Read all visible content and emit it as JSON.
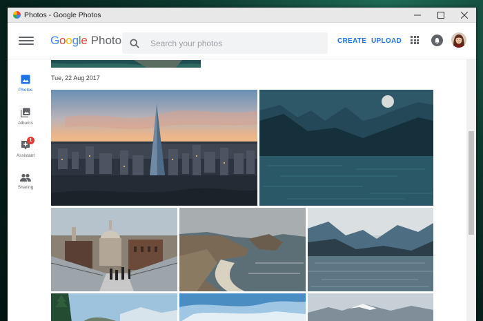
{
  "window": {
    "title": "Photos - Google Photos",
    "controls": [
      "minimize",
      "maximize",
      "close"
    ]
  },
  "header": {
    "logo_google": "Google",
    "logo_photos": "Photos",
    "search_placeholder": "Search your photos",
    "create_label": "CREATE",
    "upload_label": "UPLOAD",
    "icons": [
      "hamburger-menu-icon",
      "search-icon",
      "apps-grid-icon",
      "notifications-icon",
      "avatar"
    ]
  },
  "sidebar": {
    "items": [
      {
        "label": "Photos",
        "icon": "photos-icon",
        "active": true
      },
      {
        "label": "Albums",
        "icon": "albums-icon",
        "active": false
      },
      {
        "label": "Assistant",
        "icon": "assistant-icon",
        "active": false,
        "badge": "1"
      },
      {
        "label": "Sharing",
        "icon": "sharing-icon",
        "active": false
      }
    ]
  },
  "main": {
    "date_heading": "Tue, 22 Aug 2017",
    "photos": [
      "city-sunset-skyscraper",
      "lake-mountains-moon",
      "st-pauls-cathedral-bridge",
      "coastal-cliff-arch",
      "mountain-lake-reflection",
      "forest-trees",
      "blue-sky-clouds",
      "snowy-peak"
    ]
  },
  "colors": {
    "accent": "#1a73e8",
    "desktop": "#0d3a30",
    "google_blue": "#4285F4",
    "google_red": "#EA4335",
    "google_yellow": "#FBBC05",
    "google_green": "#34A853"
  }
}
